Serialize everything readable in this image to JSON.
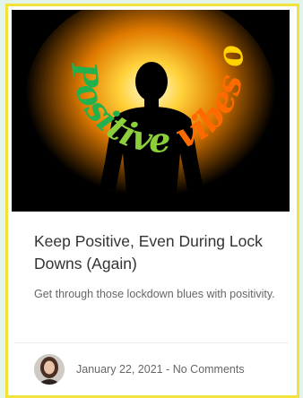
{
  "post": {
    "image_text": "Positive vibes only",
    "title": "Keep Positive, Even During Lock Downs (Again)",
    "excerpt": "Get through those lockdown blues with positivity.",
    "date": "January 22, 2021",
    "separator": " - ",
    "comments": "No Comments"
  },
  "colors": {
    "page_bg": "#e3f5ea",
    "card_border": "#f4e23c",
    "title": "#333333",
    "meta": "#666666"
  }
}
